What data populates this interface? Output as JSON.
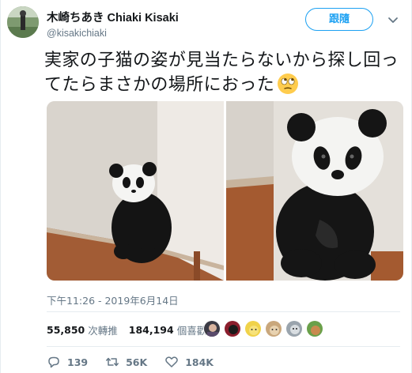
{
  "user": {
    "display_name": "木崎ちあき Chiaki Kisaki",
    "handle": "@kisakichiaki"
  },
  "follow_button": {
    "label": "跟隨"
  },
  "tweet": {
    "text": "実家の子猫の姿が見当たらないから探し回ってたらまさかの場所におった",
    "emoji": "face-with-rolling-eyes"
  },
  "timestamp": "下午11:26 - 2019年6月14日",
  "stats": {
    "retweets": "55,850",
    "retweets_label": "次轉推",
    "likes": "184,194",
    "likes_label": "個喜歡"
  },
  "actions": {
    "reply_count": "139",
    "retweet_count": "56K",
    "like_count": "184K"
  },
  "colors": {
    "accent": "#1da1f2",
    "secondary_text": "#657786",
    "divider": "#e6ecf0"
  }
}
